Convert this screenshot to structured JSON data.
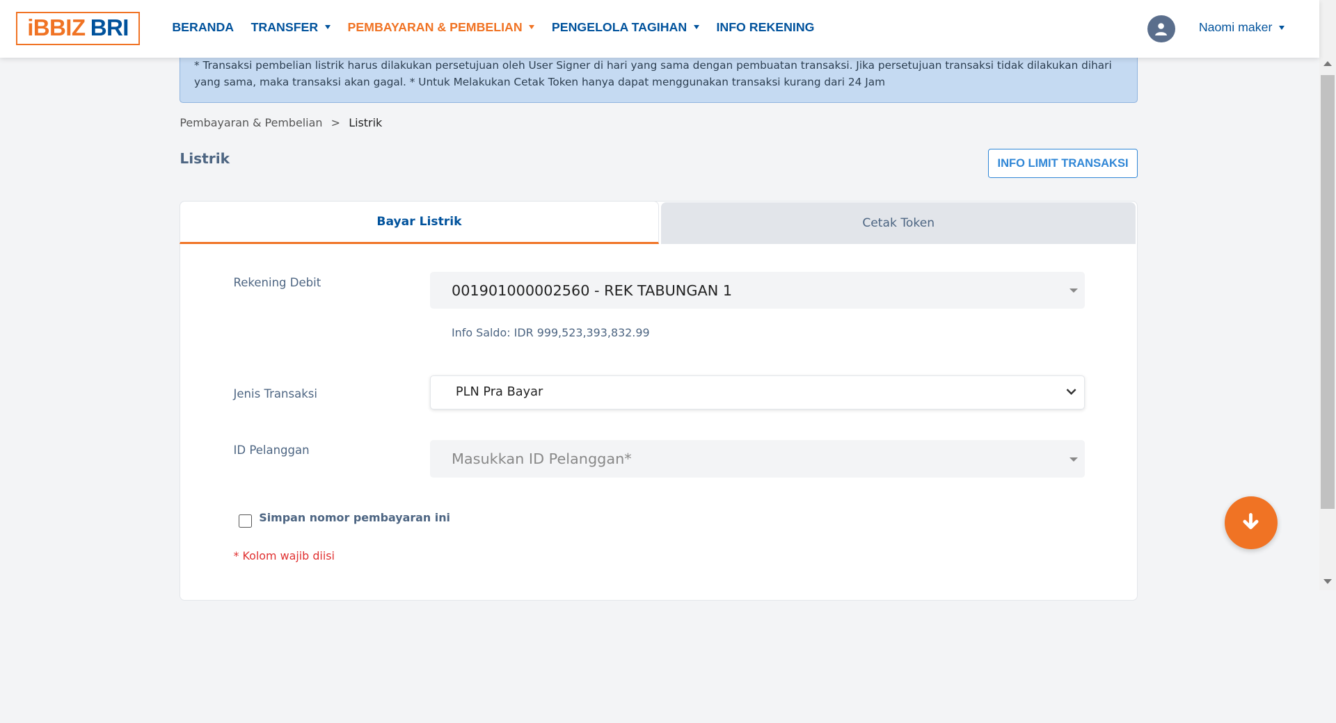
{
  "brand": {
    "logo_left": "iBBIZ",
    "logo_right": "BRI",
    "accent": "#f07324",
    "primary": "#00529c"
  },
  "nav": {
    "items": [
      {
        "label": "BERANDA",
        "dropdown": false,
        "active": false
      },
      {
        "label": "TRANSFER",
        "dropdown": true,
        "active": false
      },
      {
        "label": "PEMBAYARAN & PEMBELIAN",
        "dropdown": true,
        "active": true
      },
      {
        "label": "PENGELOLA TAGIHAN",
        "dropdown": true,
        "active": false
      },
      {
        "label": "INFO REKENING",
        "dropdown": false,
        "active": false
      }
    ],
    "user_name": "Naomi maker"
  },
  "alert": {
    "text": "* Transaksi pembelian listrik harus dilakukan persetujuan oleh User Signer di hari yang sama dengan pembuatan transaksi. Jika persetujuan transaksi tidak dilakukan dihari yang sama, maka transaksi akan gagal. * Untuk Melakukan Cetak Token hanya dapat menggunakan transaksi kurang dari 24 Jam"
  },
  "breadcrumb": {
    "parent": "Pembayaran & Pembelian",
    "separator": ">",
    "current": "Listrik"
  },
  "page": {
    "title": "Listrik",
    "info_limit_label": "INFO LIMIT TRANSAKSI"
  },
  "tabs": [
    {
      "label": "Bayar Listrik",
      "active": true
    },
    {
      "label": "Cetak Token",
      "active": false
    }
  ],
  "form": {
    "rekening_label": "Rekening Debit",
    "rekening_value": "001901000002560 - REK TABUNGAN 1",
    "saldo": "Info Saldo: IDR 999,523,393,832.99",
    "jenis_label": "Jenis Transaksi",
    "jenis_value": "PLN Pra Bayar",
    "id_label": "ID Pelanggan",
    "id_placeholder": "Masukkan ID Pelanggan*",
    "save_label": "Simpan nomor pembayaran ini",
    "save_checked": false,
    "required_note": "* Kolom wajib diisi"
  }
}
